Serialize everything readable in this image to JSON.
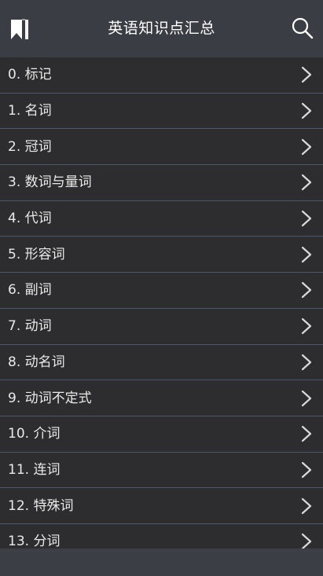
{
  "header": {
    "title": "英语知识点汇总",
    "left_icon": "bookmark-icon",
    "right_icon": "search-icon"
  },
  "list": {
    "items": [
      {
        "label": "0. 标记"
      },
      {
        "label": "1. 名词"
      },
      {
        "label": "2. 冠词"
      },
      {
        "label": "3. 数词与量词"
      },
      {
        "label": "4. 代词"
      },
      {
        "label": "5. 形容词"
      },
      {
        "label": "6. 副词"
      },
      {
        "label": "7. 动词"
      },
      {
        "label": "8. 动名词"
      },
      {
        "label": "9. 动词不定式"
      },
      {
        "label": "10. 介词"
      },
      {
        "label": "11. 连词"
      },
      {
        "label": "12. 特殊词"
      },
      {
        "label": "13. 分词"
      }
    ],
    "row_icon": "chevron-right-icon"
  },
  "colors": {
    "header_bg": "#3a3d44",
    "list_bg": "#2d2d2f",
    "divider": "#4b5a6b",
    "text": "#e9e9e9",
    "title_text": "#ffffff"
  }
}
